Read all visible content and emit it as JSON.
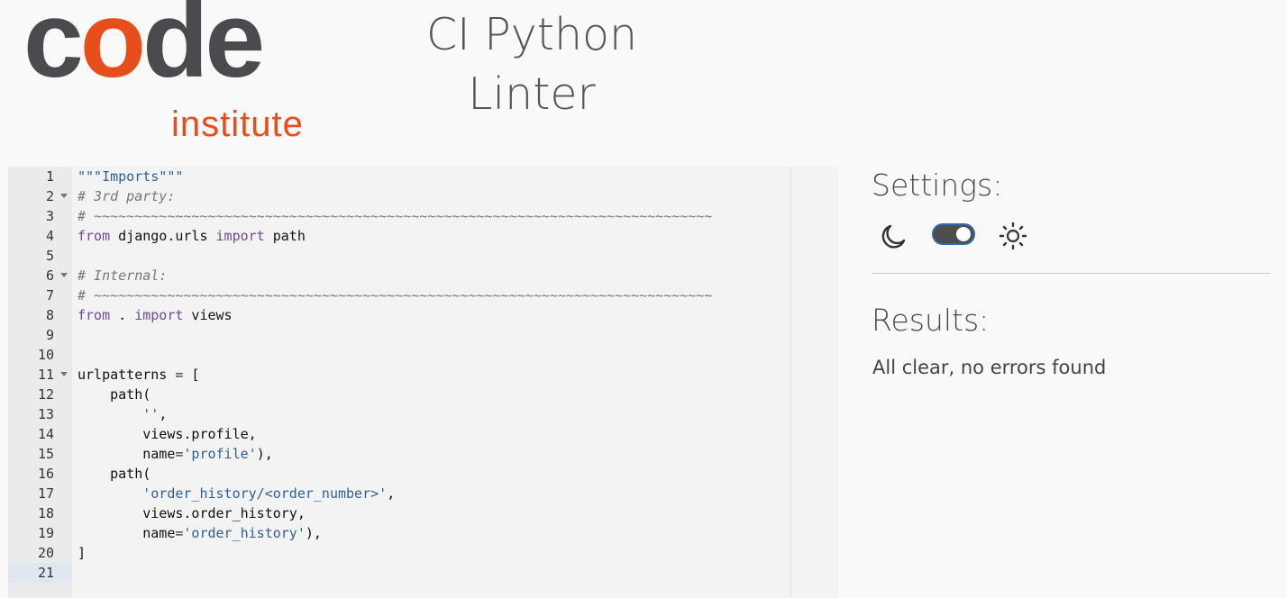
{
  "logo": {
    "code_text": "code",
    "institute_text": "institute"
  },
  "app": {
    "title_line1": "CI Python",
    "title_line2": "Linter"
  },
  "editor": {
    "lines": [
      {
        "n": "1",
        "fold": false,
        "tokens": [
          {
            "t": "\"\"\"Imports\"\"\"",
            "c": "string"
          }
        ]
      },
      {
        "n": "2",
        "fold": true,
        "tokens": [
          {
            "t": "# 3rd party:",
            "c": "comment"
          }
        ]
      },
      {
        "n": "3",
        "fold": false,
        "tokens": [
          {
            "t": "# ~~~~~~~~~~~~~~~~~~~~~~~~~~~~~~~~~~~~~~~~~~~~~~~~~~~~~~~~~~~~~~~~~~~~~~~~~~~~",
            "c": "comment"
          }
        ]
      },
      {
        "n": "4",
        "fold": false,
        "tokens": [
          {
            "t": "from",
            "c": "keyword"
          },
          {
            "t": " django.urls ",
            "c": "ident"
          },
          {
            "t": "import",
            "c": "keyword"
          },
          {
            "t": " path",
            "c": "ident"
          }
        ]
      },
      {
        "n": "5",
        "fold": false,
        "tokens": []
      },
      {
        "n": "6",
        "fold": true,
        "tokens": [
          {
            "t": "# Internal:",
            "c": "comment"
          }
        ]
      },
      {
        "n": "7",
        "fold": false,
        "tokens": [
          {
            "t": "# ~~~~~~~~~~~~~~~~~~~~~~~~~~~~~~~~~~~~~~~~~~~~~~~~~~~~~~~~~~~~~~~~~~~~~~~~~~~~",
            "c": "comment"
          }
        ]
      },
      {
        "n": "8",
        "fold": false,
        "tokens": [
          {
            "t": "from",
            "c": "keyword"
          },
          {
            "t": " . ",
            "c": "ident"
          },
          {
            "t": "import",
            "c": "keyword"
          },
          {
            "t": " views",
            "c": "ident"
          }
        ]
      },
      {
        "n": "9",
        "fold": false,
        "tokens": []
      },
      {
        "n": "10",
        "fold": false,
        "tokens": []
      },
      {
        "n": "11",
        "fold": true,
        "tokens": [
          {
            "t": "urlpatterns ",
            "c": "ident"
          },
          {
            "t": "=",
            "c": "op"
          },
          {
            "t": " [",
            "c": "ident"
          }
        ]
      },
      {
        "n": "12",
        "fold": false,
        "tokens": [
          {
            "t": "    path(",
            "c": "ident"
          }
        ]
      },
      {
        "n": "13",
        "fold": false,
        "tokens": [
          {
            "t": "        ",
            "c": "ident"
          },
          {
            "t": "''",
            "c": "string"
          },
          {
            "t": ",",
            "c": "ident"
          }
        ]
      },
      {
        "n": "14",
        "fold": false,
        "tokens": [
          {
            "t": "        views.profile,",
            "c": "ident"
          }
        ]
      },
      {
        "n": "15",
        "fold": false,
        "tokens": [
          {
            "t": "        name",
            "c": "ident"
          },
          {
            "t": "=",
            "c": "op"
          },
          {
            "t": "'profile'",
            "c": "string"
          },
          {
            "t": "),",
            "c": "ident"
          }
        ]
      },
      {
        "n": "16",
        "fold": false,
        "tokens": [
          {
            "t": "    path(",
            "c": "ident"
          }
        ]
      },
      {
        "n": "17",
        "fold": false,
        "tokens": [
          {
            "t": "        ",
            "c": "ident"
          },
          {
            "t": "'order_history/<order_number>'",
            "c": "string"
          },
          {
            "t": ",",
            "c": "ident"
          }
        ]
      },
      {
        "n": "18",
        "fold": false,
        "tokens": [
          {
            "t": "        views.order_history,",
            "c": "ident"
          }
        ]
      },
      {
        "n": "19",
        "fold": false,
        "tokens": [
          {
            "t": "        name",
            "c": "ident"
          },
          {
            "t": "=",
            "c": "op"
          },
          {
            "t": "'order_history'",
            "c": "string"
          },
          {
            "t": "),",
            "c": "ident"
          }
        ]
      },
      {
        "n": "20",
        "fold": false,
        "tokens": [
          {
            "t": "]",
            "c": "ident"
          }
        ]
      },
      {
        "n": "21",
        "fold": false,
        "active": true,
        "tokens": []
      }
    ]
  },
  "settings": {
    "title": "Settings:",
    "moon_icon": "moon-icon",
    "sun_icon": "sun-icon",
    "toggle_state": "on"
  },
  "results": {
    "title": "Results:",
    "message": "All clear, no errors found"
  },
  "colors": {
    "brand_gray": "#4a4a4f",
    "brand_orange": "#e84e1b",
    "toggle_border": "#2e69b3"
  }
}
